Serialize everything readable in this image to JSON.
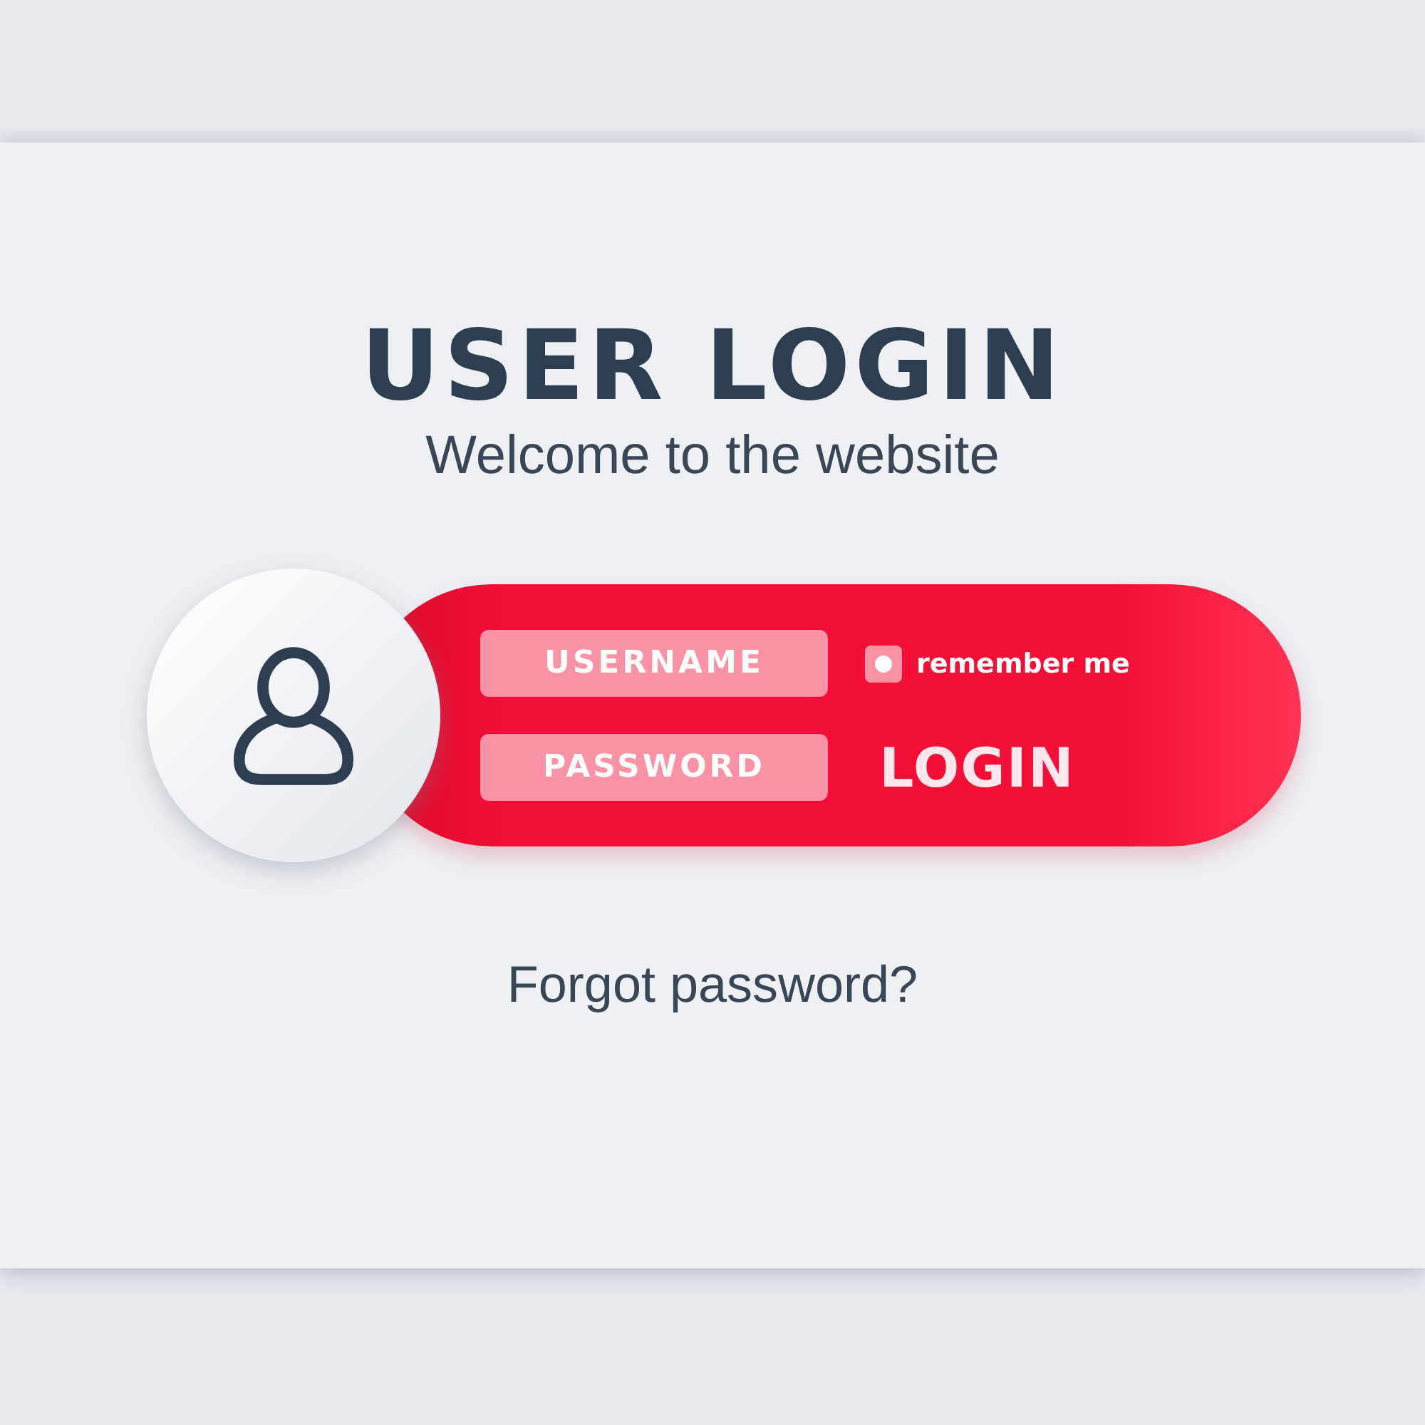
{
  "title": "USER LOGIN",
  "subtitle": "Welcome to the website",
  "username": {
    "placeholder": "USERNAME"
  },
  "password": {
    "placeholder": "PASSWORD"
  },
  "remember": {
    "label": "remember me",
    "checked": true
  },
  "login_button": "LOGIN",
  "forgot_link": "Forgot password?"
}
